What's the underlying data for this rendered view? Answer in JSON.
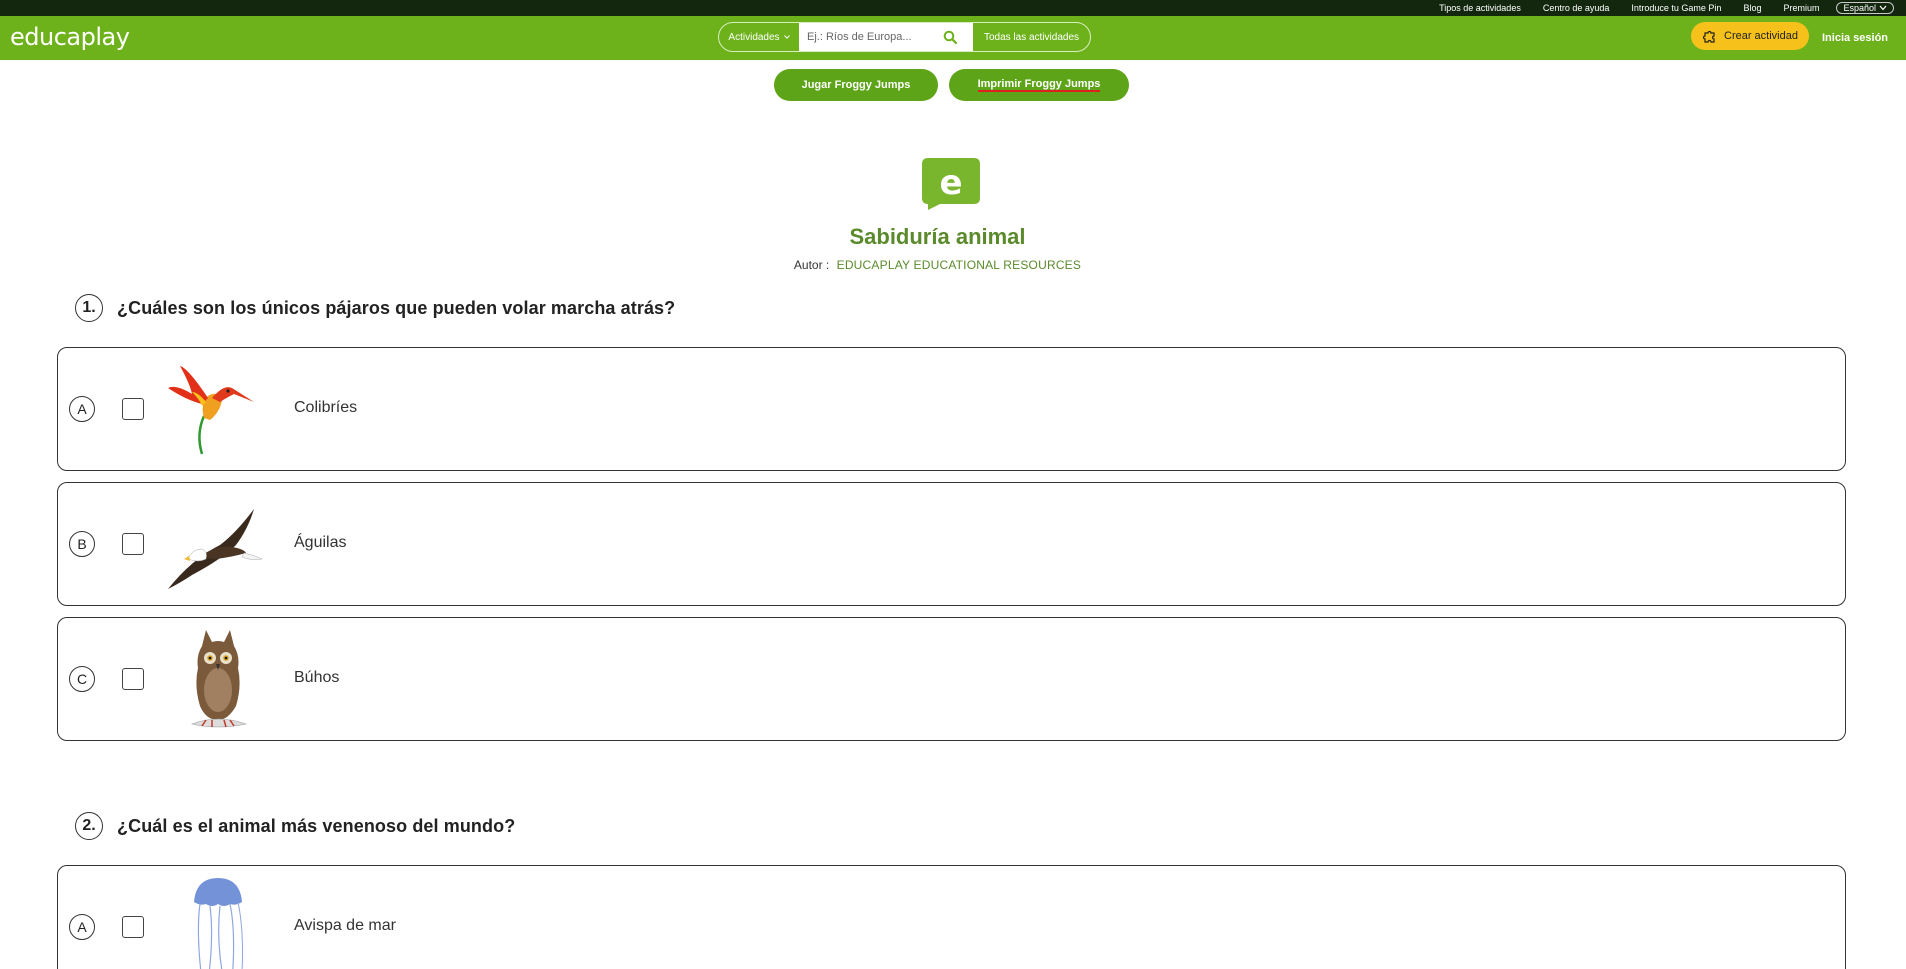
{
  "topbar": {
    "links": [
      "Tipos de actividades",
      "Centro de ayuda",
      "Introduce tu Game Pin",
      "Blog",
      "Premium"
    ],
    "language": "Español"
  },
  "header": {
    "logo": "educaplay",
    "search": {
      "category": "Actividades",
      "placeholder": "Ej.: Ríos de Europa...",
      "all_label": "Todas las actividades"
    },
    "create_label": "Crear actividad",
    "login_label": "Inicia sesión"
  },
  "actions": {
    "play_label": "Jugar Froggy Jumps",
    "print_label": "Imprimir Froggy Jumps"
  },
  "activity": {
    "title": "Sabiduría animal",
    "author_label": "Autor :",
    "author_name": "EDUCAPLAY EDUCATIONAL RESOURCES"
  },
  "questions": [
    {
      "number": "1.",
      "text": "¿Cuáles son los únicos pájaros que pueden volar marcha atrás?",
      "answers": [
        {
          "letter": "A",
          "text": "Colibríes",
          "image": "hummingbird-image"
        },
        {
          "letter": "B",
          "text": "Águilas",
          "image": "eagle-image"
        },
        {
          "letter": "C",
          "text": "Búhos",
          "image": "owl-image"
        }
      ]
    },
    {
      "number": "2.",
      "text": "¿Cuál es el animal más venenoso del mundo?",
      "answers": [
        {
          "letter": "A",
          "text": "Avispa de mar",
          "image": "jellyfish-image"
        }
      ]
    }
  ],
  "colors": {
    "brand_green": "#6db21b",
    "button_green": "#5ea418",
    "title_green": "#5a8a2b",
    "top_dark": "#13270f",
    "create_yellow": "#f6c11b"
  }
}
